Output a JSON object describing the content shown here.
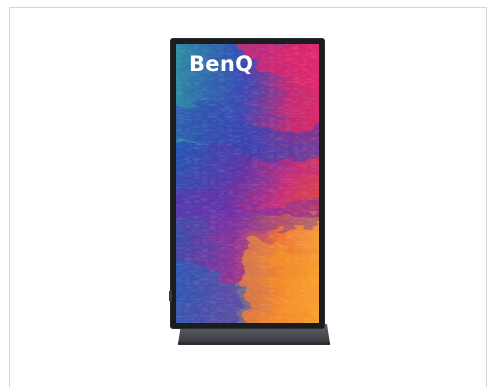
{
  "product": {
    "brand_logo_text": "BenQ",
    "frame_color": "#1b1c1e",
    "stand_color": "#4a4d52",
    "wallpaper_palette": [
      "#1e8a8a",
      "#1f4aa8",
      "#5a2ea0",
      "#c8257a",
      "#e0402a",
      "#f07a1e",
      "#f5b21d"
    ]
  }
}
